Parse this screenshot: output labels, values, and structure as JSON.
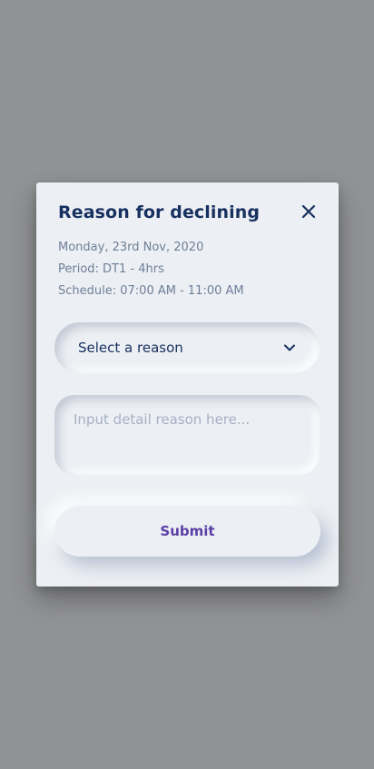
{
  "dialog": {
    "title": "Reason for declining",
    "date": "Monday, 23rd Nov, 2020",
    "period": "Period: DT1 - 4hrs",
    "schedule": "Schedule: 07:00 AM - 11:00 AM",
    "close_icon": "close-icon"
  },
  "form": {
    "reason_select": {
      "selected": "Select a reason",
      "icon": "chevron-down-icon"
    },
    "detail_input": {
      "value": "",
      "placeholder": "Input detail reason here..."
    },
    "submit_label": "Submit"
  },
  "colors": {
    "overlay": "#919294",
    "card": "#eceff3",
    "title": "#17305f",
    "info_text": "#6f7f98",
    "placeholder": "#a6b1c5",
    "submit_text": "#5b3fa6"
  }
}
